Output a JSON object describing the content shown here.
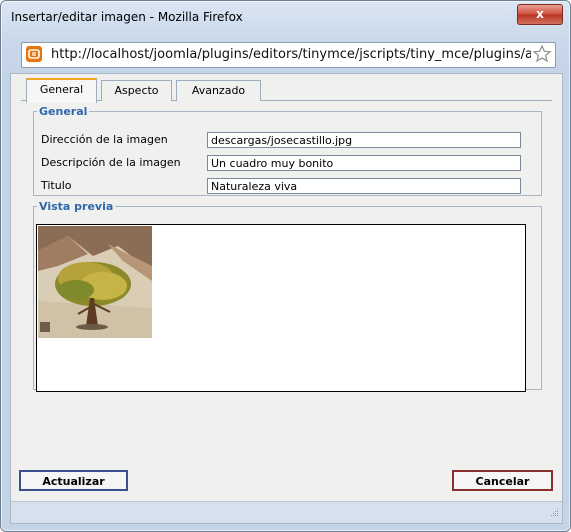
{
  "window": {
    "title": "Insertar/editar imagen - Mozilla Firefox",
    "close_label": "x"
  },
  "urlbar": {
    "url": "http://localhost/joomla/plugins/editors/tinymce/jscripts/tiny_mce/plugins/a"
  },
  "tabs": [
    {
      "label": "General",
      "active": true
    },
    {
      "label": "Aspecto",
      "active": false
    },
    {
      "label": "Avanzado",
      "active": false
    }
  ],
  "general": {
    "legend": "General",
    "fields": [
      {
        "label": "Dirección de la imagen",
        "value": "descargas/josecastillo.jpg"
      },
      {
        "label": "Descripción de la imagen",
        "value": "Un cuadro muy bonito"
      },
      {
        "label": "Titulo",
        "value": "Naturaleza viva"
      }
    ]
  },
  "preview": {
    "legend": "Vista previa"
  },
  "buttons": {
    "update": "Actualizar",
    "cancel": "Cancelar"
  },
  "icons": {
    "favicon": "firefox-page-icon",
    "bookmark": "star-icon",
    "resize": "resize-grip-icon"
  },
  "colors": {
    "accent_tab": "#f5a623",
    "legend": "#2f67ad",
    "close": "#cf4e3c"
  }
}
